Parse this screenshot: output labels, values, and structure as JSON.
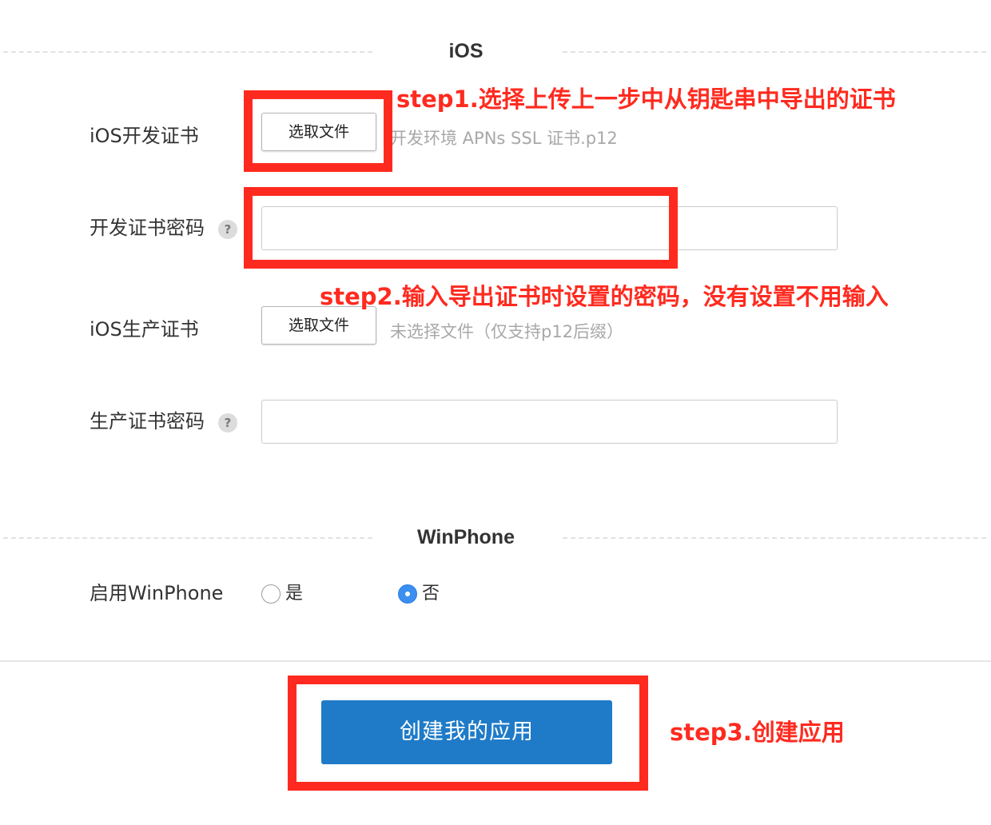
{
  "ios_section": {
    "title": "iOS",
    "dev_cert_label": "iOS开发证书",
    "dev_cert_button": "选取文件",
    "dev_cert_filename": "开发环境 APNs SSL 证书.p12",
    "dev_password_label": "开发证书密码",
    "dev_password_value": "",
    "prod_cert_label": "iOS生产证书",
    "prod_cert_button": "选取文件",
    "prod_cert_filename": "未选择文件（仅支持p12后缀）",
    "prod_password_label": "生产证书密码",
    "prod_password_value": "",
    "help_icon": "?"
  },
  "winphone_section": {
    "title": "WinPhone",
    "enable_label": "启用WinPhone",
    "options": [
      {
        "label": "是",
        "selected": false
      },
      {
        "label": "否",
        "selected": true
      }
    ]
  },
  "footer": {
    "create_button": "创建我的应用"
  },
  "annotations": {
    "step1": "step1.选择上传上一步中从钥匙串中导出的证书",
    "step2": "step2.输入导出证书时设置的密码，没有设置不用输入",
    "step3": "step3.创建应用",
    "color": "#ff2a1f"
  },
  "colors": {
    "primary_button": "#1f7bc8",
    "radio_selected": "#3b8ff0",
    "annotation_red": "#ff2a1f"
  }
}
